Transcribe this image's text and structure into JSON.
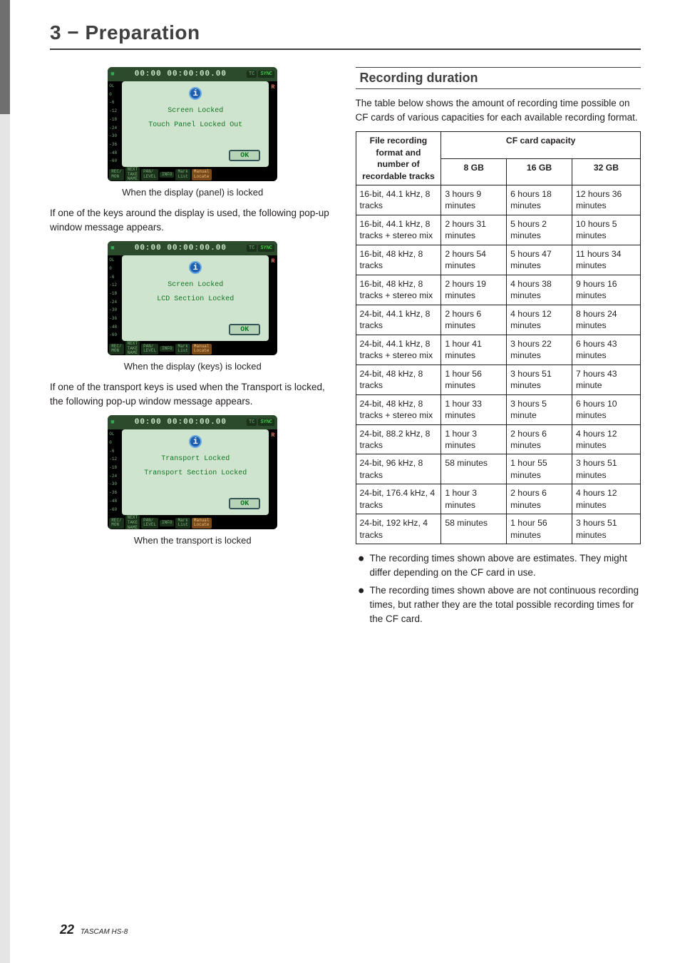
{
  "chapter": "3 − Preparation",
  "left": {
    "lcdCommon": {
      "counter": "00:00 00:00:00.00",
      "tcLabel": "TC",
      "syncLabel": "SYNC",
      "meterLabels": [
        "OL",
        "0",
        "-6",
        "-12",
        "-18",
        "-24",
        "-30",
        "-36",
        "-48",
        "-60"
      ],
      "rightSide": "R",
      "infoGlyph": "i",
      "ok": "OK",
      "bottom": [
        "REC/\nMON",
        "NEXT\nTAKE\nNAME",
        "PAN/\nLEVEL",
        "INFO",
        "Mark\nList",
        "Manual\nLocate"
      ]
    },
    "popups": [
      {
        "line1": "Screen Locked",
        "line2": "Touch Panel Locked Out",
        "caption": "When the display (panel) is locked"
      },
      {
        "line1": "Screen Locked",
        "line2": "LCD Section Locked",
        "caption": "When the display (keys) is locked"
      },
      {
        "line1": "Transport Locked",
        "line2": "Transport Section Locked",
        "caption": "When the transport is locked"
      }
    ],
    "para1": "If one of the keys around the display is used, the following pop-up window message appears.",
    "para2": "If one of the transport keys is used when the Transport is locked, the following pop-up window message appears."
  },
  "right": {
    "heading": "Recording duration",
    "intro": "The table below shows the amount of recording time possible on CF cards of various capacities for each available recording format.",
    "table": {
      "rowHeader": "File recording format and number of recordable tracks",
      "capHeader": "CF card capacity",
      "caps": [
        "8 GB",
        "16 GB",
        "32 GB"
      ],
      "rows": [
        {
          "f": "16-bit, 44.1 kHz, 8 tracks",
          "c": [
            "3 hours 9 minutes",
            "6 hours 18 minutes",
            "12 hours 36 minutes"
          ]
        },
        {
          "f": "16-bit, 44.1 kHz, 8 tracks + stereo mix",
          "c": [
            "2 hours 31 minutes",
            "5 hours 2 minutes",
            "10 hours 5 minutes"
          ]
        },
        {
          "f": "16-bit, 48 kHz, 8 tracks",
          "c": [
            "2 hours 54 minutes",
            "5 hours 47 minutes",
            "11 hours 34 minutes"
          ]
        },
        {
          "f": "16-bit, 48 kHz, 8 tracks + stereo mix",
          "c": [
            "2 hours 19 minutes",
            "4 hours 38 minutes",
            "9 hours 16 minutes"
          ]
        },
        {
          "f": "24-bit, 44.1 kHz, 8 tracks",
          "c": [
            "2 hours 6 minutes",
            "4 hours 12 minutes",
            "8 hours 24 minutes"
          ]
        },
        {
          "f": "24-bit, 44.1 kHz, 8 tracks + stereo mix",
          "c": [
            "1 hour 41 minutes",
            "3 hours 22 minutes",
            "6 hours 43 minutes"
          ]
        },
        {
          "f": "24-bit, 48 kHz, 8 tracks",
          "c": [
            "1 hour 56 minutes",
            "3 hours 51 minutes",
            "7 hours 43 minute"
          ]
        },
        {
          "f": "24-bit, 48 kHz, 8 tracks + stereo mix",
          "c": [
            "1 hour 33 minutes",
            "3 hours 5 minute",
            "6 hours 10 minutes"
          ]
        },
        {
          "f": "24-bit, 88.2 kHz, 8 tracks",
          "c": [
            "1 hour 3 minutes",
            "2 hours 6 minutes",
            "4 hours 12 minutes"
          ]
        },
        {
          "f": "24-bit, 96 kHz, 8 tracks",
          "c": [
            "58 minutes",
            "1 hour 55 minutes",
            "3 hours 51 minutes"
          ]
        },
        {
          "f": "24-bit, 176.4 kHz, 4 tracks",
          "c": [
            "1 hour 3 minutes",
            "2 hours 6 minutes",
            "4 hours 12 minutes"
          ]
        },
        {
          "f": "24-bit, 192 kHz, 4 tracks",
          "c": [
            "58 minutes",
            "1 hour 56 minutes",
            "3 hours 51 minutes"
          ]
        }
      ]
    },
    "bullets": [
      "The recording times shown above are estimates. They might differ depending on the CF card in use.",
      "The recording times shown above are not continuous recording times, but rather they are the total possible recording times for the CF card."
    ]
  },
  "footer": {
    "page": "22",
    "model": "TASCAM  HS-8"
  }
}
